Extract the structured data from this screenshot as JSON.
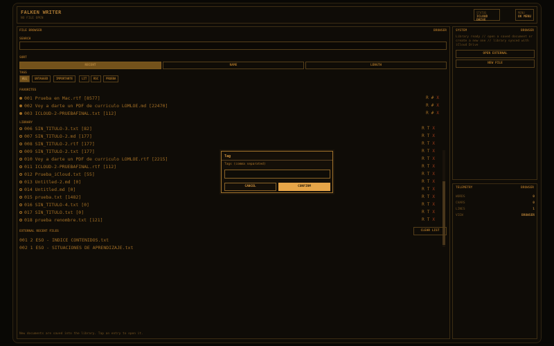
{
  "header": {
    "title": "FALKEN WRITER",
    "subtitle": "NO FILE OPEN",
    "status_label": "STATUS",
    "status_value": "ICLOUD DRIVE",
    "menu_label": "MENU",
    "menu_value": "OK MENU"
  },
  "browser": {
    "title": "FILE BROWSER",
    "right_label": "BROWSER",
    "search_label": "SEARCH",
    "search_value": "",
    "sort_label": "SORT",
    "sort_options": [
      "RECENT",
      "NAME",
      "LENGTH"
    ],
    "tags_label": "TAGS",
    "tags": [
      "ALL",
      "UNTAGGED",
      "IMPORTANTE",
      "LIT",
      "RSC",
      "PRUEBA"
    ],
    "favorites_label": "FAVORITES",
    "favorites": [
      {
        "num": "001",
        "name": "Prueba en Mac.rtf",
        "size": "[8577]"
      },
      {
        "num": "002",
        "name": "Voy a darte un PDF de curriculo LOMLOE.md",
        "size": "[22470]"
      },
      {
        "num": "003",
        "name": "ICLOUD-2-PRUEBAFINAL.txt",
        "size": "[112]"
      }
    ],
    "library_label": "LIBRARY",
    "library": [
      {
        "num": "006",
        "name": "SIN_TITULO-3.txt",
        "size": "[82]"
      },
      {
        "num": "007",
        "name": "SIN_TITULO-2.md",
        "size": "[177]"
      },
      {
        "num": "008",
        "name": "SIN_TITULO-2.rtf",
        "size": "[177]"
      },
      {
        "num": "009",
        "name": "SIN_TITULO-2.txt",
        "size": "[177]"
      },
      {
        "num": "010",
        "name": "Voy a darte un PDF de curriculo LOMLOE.rtf",
        "size": "[2215]"
      },
      {
        "num": "011",
        "name": "ICLOUD-2-PRUEBAFINAL.rtf",
        "size": "[112]"
      },
      {
        "num": "012",
        "name": "Prueba_iCloud.txt",
        "size": "[55]"
      },
      {
        "num": "013",
        "name": "Untitled-2.md",
        "size": "[0]"
      },
      {
        "num": "014",
        "name": "Untitled.md",
        "size": "[0]"
      },
      {
        "num": "015",
        "name": "prueba.txt",
        "size": "[1482]"
      },
      {
        "num": "016",
        "name": "SIN_TITULO-4.txt",
        "size": "[0]"
      },
      {
        "num": "017",
        "name": "SIN_TITULO.txt",
        "size": "[0]"
      },
      {
        "num": "018",
        "name": "prueba renombre.txt",
        "size": "[121]"
      }
    ],
    "external_label": "EXTERNAL RECENT FILES",
    "clear_label": "CLEAR LIST",
    "external": [
      {
        "num": "001",
        "name": "2 ESO - INDICE CONTENIDOS.txt"
      },
      {
        "num": "002",
        "name": "1 ESO - SITUACIONES DE APRENDIZAJE.txt"
      }
    ],
    "footer": "New documents are saved into the library. Tap an entry to open it."
  },
  "actions": {
    "fav": [
      "R",
      "#",
      "X"
    ],
    "lib": [
      "R",
      "T",
      "X"
    ]
  },
  "system": {
    "title": "SYSTEM",
    "right_label": "BROWSER",
    "description": "Library ready // open a saved document or create a new one // library synced with iCloud Drive",
    "open_external": "OPEN EXTERNAL",
    "new_file": "NEW FILE"
  },
  "telemetry": {
    "title": "TELEMETRY",
    "right_label": "BROWSER",
    "rows": [
      {
        "label": "WORDS",
        "value": "0"
      },
      {
        "label": "CHARS",
        "value": "0"
      },
      {
        "label": "LINES",
        "value": "1"
      },
      {
        "label": "VIEW",
        "value": "BROWSER"
      }
    ]
  },
  "dialog": {
    "title": "Tag",
    "label": "Tags (comma separated)",
    "input_value": "",
    "cancel": "CANCEL",
    "confirm": "CONFIRM"
  },
  "colors": {
    "accent": "#c9892e",
    "danger": "#c24a20",
    "background": "#130f09"
  }
}
